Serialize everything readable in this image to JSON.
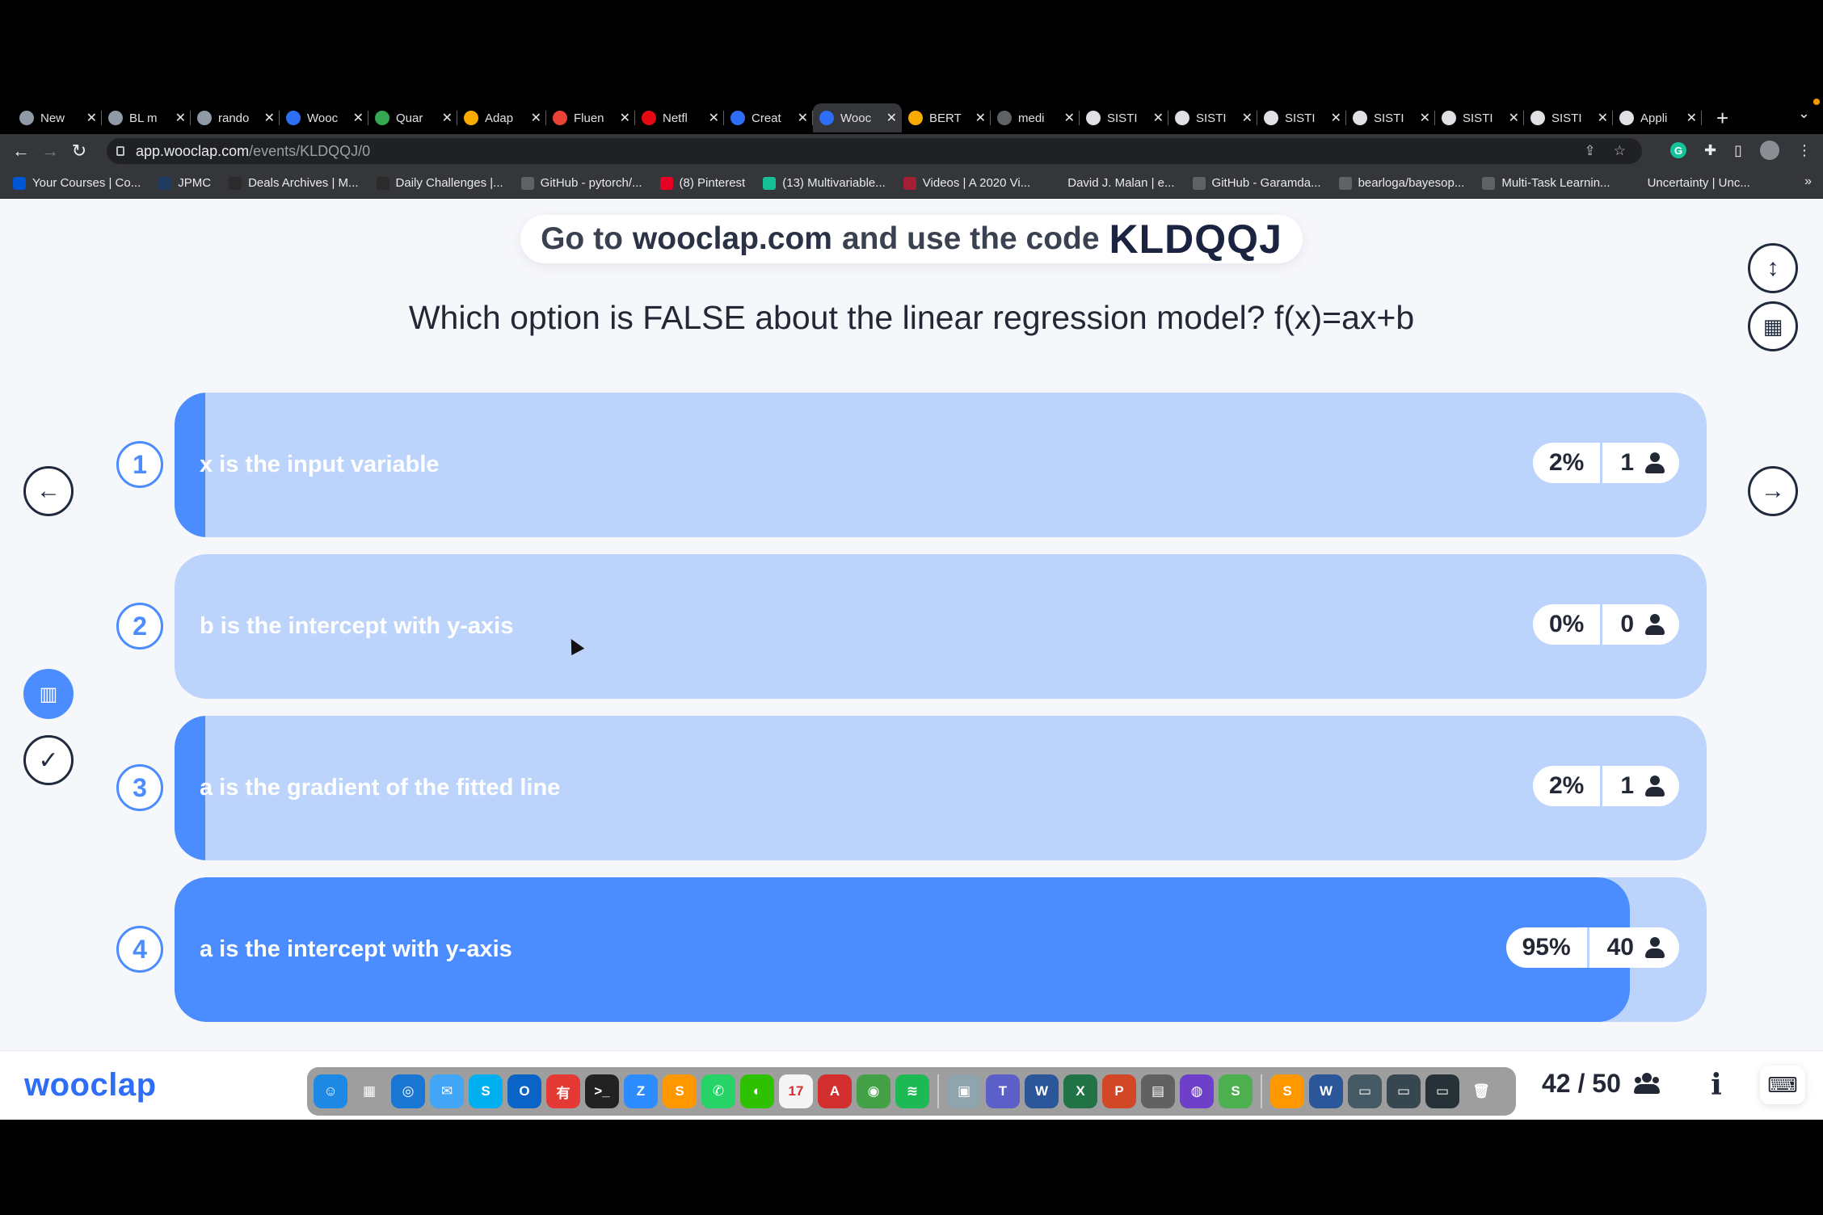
{
  "browser": {
    "tabs": [
      {
        "title": "New",
        "icon": "openai-icon",
        "color": "#8e9aa5"
      },
      {
        "title": "BL m",
        "icon": "openai-icon",
        "color": "#8e9aa5"
      },
      {
        "title": "rando",
        "icon": "openai-icon",
        "color": "#8e9aa5"
      },
      {
        "title": "Wooc",
        "icon": "wooclap-icon",
        "color": "#2e6df6"
      },
      {
        "title": "Quar",
        "icon": "google-drive-icon",
        "color": "#34a853"
      },
      {
        "title": "Adap",
        "icon": "colab-icon",
        "color": "#f9ab00"
      },
      {
        "title": "Fluen",
        "icon": "chrome-icon",
        "color": "#ea4335"
      },
      {
        "title": "Netfl",
        "icon": "netflix-icon",
        "color": "#e50914"
      },
      {
        "title": "Creat",
        "icon": "wooclap-icon",
        "color": "#2e6df6"
      },
      {
        "title": "Wooc",
        "icon": "wooclap-icon",
        "color": "#2e6df6",
        "active": true
      },
      {
        "title": "BERT",
        "icon": "colab-icon",
        "color": "#f9ab00"
      },
      {
        "title": "medi",
        "icon": "github-icon",
        "color": "#5f6368"
      },
      {
        "title": "SISTI",
        "icon": "doc-icon",
        "color": "#dfe1e5"
      },
      {
        "title": "SISTI",
        "icon": "doc-icon",
        "color": "#dfe1e5"
      },
      {
        "title": "SISTI",
        "icon": "doc-icon",
        "color": "#dfe1e5"
      },
      {
        "title": "SISTI",
        "icon": "doc-icon",
        "color": "#dfe1e5"
      },
      {
        "title": "SISTI",
        "icon": "doc-icon",
        "color": "#dfe1e5"
      },
      {
        "title": "SISTI",
        "icon": "doc-icon",
        "color": "#dfe1e5"
      },
      {
        "title": "Appli",
        "icon": "lock-doc-icon",
        "color": "#dfe1e5"
      }
    ],
    "url_host": "app.wooclap.com",
    "url_path": "/events/KLDQQJ/0",
    "bookmarks": [
      {
        "label": "Your Courses | Co...",
        "icon": "coursera-icon",
        "color": "#0056d2"
      },
      {
        "label": "JPMC",
        "icon": "folder-icon",
        "color": "#1f3a60"
      },
      {
        "label": "Deals Archives | M...",
        "icon": "deals-icon",
        "color": "#2b2b2b"
      },
      {
        "label": "Daily Challenges |...",
        "icon": "challenge-icon",
        "color": "#2b2b2b"
      },
      {
        "label": "GitHub - pytorch/...",
        "icon": "github-icon",
        "color": "#5f6368"
      },
      {
        "label": "(8) Pinterest",
        "icon": "pinterest-icon",
        "color": "#e60023"
      },
      {
        "label": "(13) Multivariable...",
        "icon": "khan-icon",
        "color": "#14bf96"
      },
      {
        "label": "Videos | A 2020 Vi...",
        "icon": "mit-icon",
        "color": "#a31f34"
      },
      {
        "label": "David J. Malan | e...",
        "icon": "x-icon",
        "color": "#35363a"
      },
      {
        "label": "GitHub - Garamda...",
        "icon": "github-icon",
        "color": "#5f6368"
      },
      {
        "label": "bearloga/bayesop...",
        "icon": "github-icon",
        "color": "#5f6368"
      },
      {
        "label": "Multi-Task Learnin...",
        "icon": "globe-icon",
        "color": "#5f6368"
      },
      {
        "label": "Uncertainty | Unc...",
        "icon": "x-icon",
        "color": "#35363a"
      }
    ]
  },
  "wooclap": {
    "banner": {
      "prefix": "Go to",
      "domain": "wooclap.com",
      "middle": "and use the code",
      "code": "KLDQQJ"
    },
    "question": "Which option is FALSE about the linear regression model? f(x)=ax+b",
    "options": [
      {
        "number": "1",
        "label": "x is the input variable",
        "percent": "2%",
        "votes": "1",
        "fill": 0.02
      },
      {
        "number": "2",
        "label": "b is the intercept with y-axis",
        "percent": "0%",
        "votes": "0",
        "fill": 0.0
      },
      {
        "number": "3",
        "label": "a is the gradient of the fitted line",
        "percent": "2%",
        "votes": "1",
        "fill": 0.02
      },
      {
        "number": "4",
        "label": "a is the intercept with y-axis",
        "percent": "95%",
        "votes": "40",
        "fill": 0.95
      }
    ],
    "logo": "wooclap",
    "answered": "42",
    "total": "50",
    "counter": "42 / 50",
    "accent": "#4b8cff",
    "option_bg": "#bcd4fb"
  },
  "dock": {
    "apps": [
      {
        "icon": "finder-icon",
        "glyph": "☺",
        "color": "#1e88e5"
      },
      {
        "icon": "launchpad-icon",
        "glyph": "▦",
        "color": "#9e9e9e"
      },
      {
        "icon": "safari-icon",
        "glyph": "◎",
        "color": "#1976d2"
      },
      {
        "icon": "mail-icon",
        "glyph": "✉",
        "color": "#42a5f5"
      },
      {
        "icon": "skype-icon",
        "glyph": "S",
        "color": "#00aff0"
      },
      {
        "icon": "outlook-icon",
        "glyph": "O",
        "color": "#0a64c8"
      },
      {
        "icon": "youdao-icon",
        "glyph": "有",
        "color": "#e53935"
      },
      {
        "icon": "terminal-icon",
        "glyph": ">_",
        "color": "#222222"
      },
      {
        "icon": "zoom-icon",
        "glyph": "Z",
        "color": "#2d8cff"
      },
      {
        "icon": "sublime-icon",
        "glyph": "S",
        "color": "#ff9800"
      },
      {
        "icon": "whatsapp-icon",
        "glyph": "✆",
        "color": "#25d366"
      },
      {
        "icon": "wechat-icon",
        "glyph": "◐",
        "color": "#2dc100"
      },
      {
        "icon": "calendar-icon",
        "glyph": "17",
        "color": "#f5f5f5"
      },
      {
        "icon": "acrobat-icon",
        "glyph": "A",
        "color": "#d32f2f"
      },
      {
        "icon": "chrome-icon",
        "glyph": "◉",
        "color": "#43a047"
      },
      {
        "icon": "spotify-icon",
        "glyph": "≋",
        "color": "#1db954"
      },
      {
        "icon": "preview-icon",
        "glyph": "▣",
        "color": "#90a4ae"
      },
      {
        "icon": "teams-icon",
        "glyph": "T",
        "color": "#5b5fc7"
      },
      {
        "icon": "word-icon",
        "glyph": "W",
        "color": "#2b579a"
      },
      {
        "icon": "excel-icon",
        "glyph": "X",
        "color": "#217346"
      },
      {
        "icon": "powerpoint-icon",
        "glyph": "P",
        "color": "#d24726"
      },
      {
        "icon": "calculator-icon",
        "glyph": "▤",
        "color": "#616161"
      },
      {
        "icon": "github-desktop-icon",
        "glyph": "◍",
        "color": "#6e40c9"
      },
      {
        "icon": "scrivener-icon",
        "glyph": "S",
        "color": "#4caf50"
      },
      {
        "icon": "pages-icon",
        "glyph": "S",
        "color": "#ff9800"
      },
      {
        "icon": "word-doc-icon",
        "glyph": "W",
        "color": "#2b579a"
      },
      {
        "icon": "window-icon",
        "glyph": "▭",
        "color": "#455a64"
      },
      {
        "icon": "window-icon",
        "glyph": "▭",
        "color": "#37474f"
      },
      {
        "icon": "window-icon",
        "glyph": "▭",
        "color": "#263238"
      },
      {
        "icon": "trash-icon",
        "glyph": "🗑",
        "color": "#9e9e9e"
      }
    ]
  }
}
